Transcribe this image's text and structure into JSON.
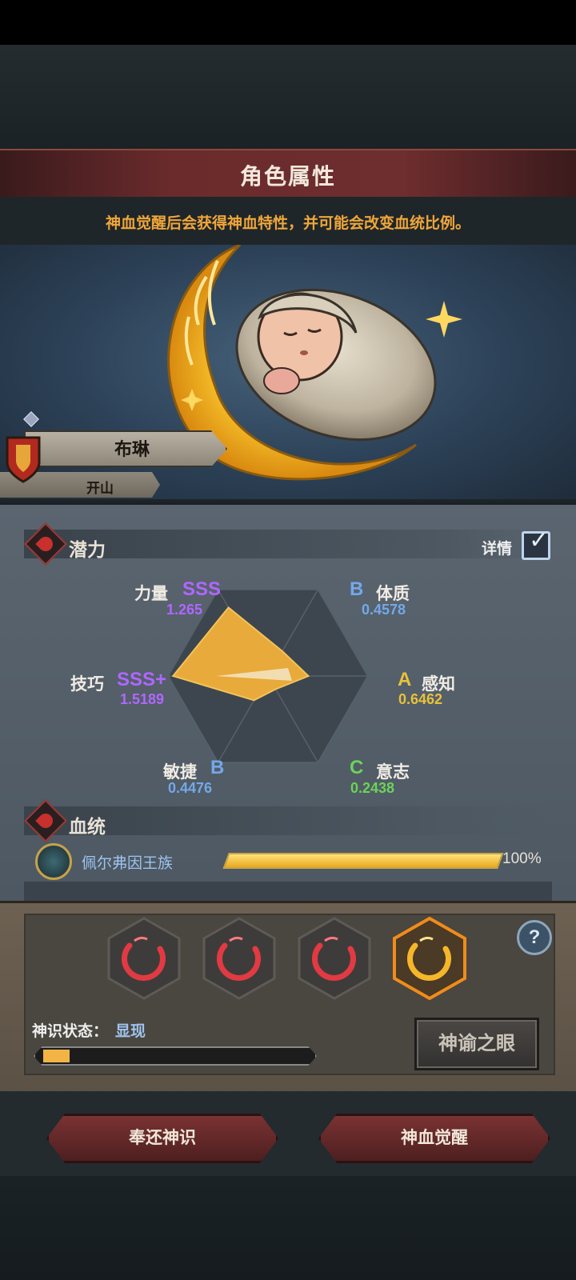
{
  "header": {
    "title": "角色属性",
    "subtitle": "神血觉醒后会获得神血特性，并可能会改变血统比例。"
  },
  "character": {
    "name": "布琳",
    "title": "开山"
  },
  "potential": {
    "section_title": "潜力",
    "detail_label": "详情",
    "detail_checked": true,
    "stats": [
      {
        "name": "力量",
        "grade": "SSS",
        "value": "1.265"
      },
      {
        "name": "体质",
        "grade": "B",
        "value": "0.4578"
      },
      {
        "name": "感知",
        "grade": "A",
        "value": "0.6462"
      },
      {
        "name": "意志",
        "grade": "C",
        "value": "0.2438"
      },
      {
        "name": "敏捷",
        "grade": "B",
        "value": "0.4476"
      },
      {
        "name": "技巧",
        "grade": "SSS+",
        "value": "1.5189"
      }
    ],
    "colors": {
      "SSS": "#b067ff",
      "B": "#74a8e8",
      "A": "#e8c23a",
      "C": "#6cd25a",
      "radar_fill": "#e8aa3a"
    }
  },
  "bloodline": {
    "section_title": "血统",
    "name": "佩尔弗因王族",
    "percent_value": 100,
    "percent_label": "100%"
  },
  "divine": {
    "rune_icons": [
      "crescent-red-icon",
      "crescent-red-icon",
      "crescent-red-icon",
      "crescent-gold-icon"
    ],
    "help_glyph": "?",
    "state_label": "神识状态：",
    "state_value": "显现",
    "progress_value": 0.1,
    "oracle_button": "神谕之眼"
  },
  "actions": {
    "return_button": "奉还神识",
    "awaken_button": "神血觉醒"
  }
}
